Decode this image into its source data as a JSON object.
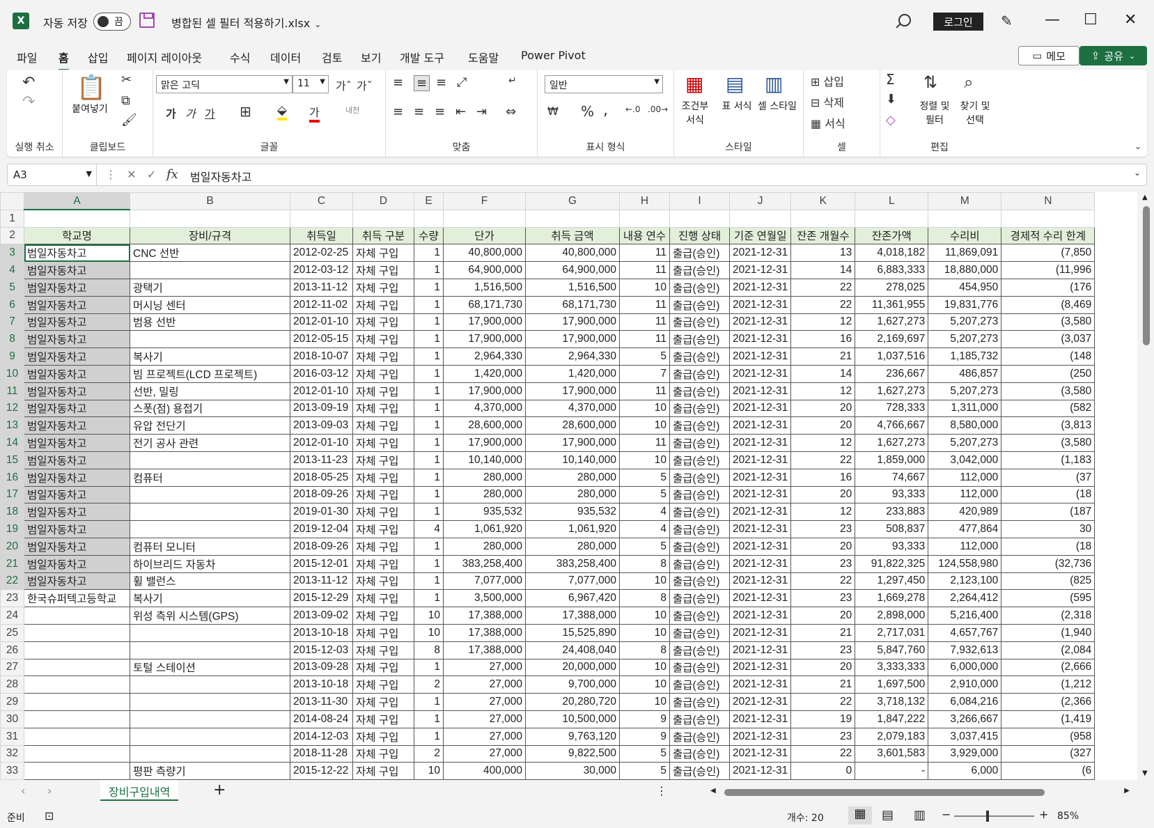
{
  "titlebar": {
    "autosave_label": "자동 저장",
    "autosave_state": "끔",
    "filename": "병합된 셀 필터 적용하기.xlsx",
    "login_label": "로그인"
  },
  "tabs": [
    "파일",
    "홈",
    "삽입",
    "페이지 레이아웃",
    "수식",
    "데이터",
    "검토",
    "보기",
    "개발 도구",
    "도움말",
    "Power Pivot"
  ],
  "active_tab": "홈",
  "memo_label": "메모",
  "share_label": "공유",
  "ribbon": {
    "undo_group": "실행 취소",
    "clipboard_group": "클립보드",
    "paste_label": "붙여넣기",
    "font_group": "글꼴",
    "font_name": "맑은 고딕",
    "font_size": "11",
    "bold": "가",
    "italic": "가",
    "underline": "가",
    "align_group": "맞춤",
    "number_group": "표시 형식",
    "number_format": "일반",
    "style_group": "스타일",
    "cond_format": "조건부 서식",
    "table_format": "표 서식",
    "cell_style": "셀 스타일",
    "cells_group": "셀",
    "insert": "삽입",
    "delete": "삭제",
    "format": "서식",
    "edit_group": "편집",
    "sort_filter": "정렬 및 필터",
    "find_select": "찾기 및 선택"
  },
  "formula_bar": {
    "name_box": "A3",
    "content": "범일자동차고"
  },
  "columns": [
    "A",
    "B",
    "C",
    "D",
    "E",
    "F",
    "G",
    "H",
    "I",
    "J",
    "K",
    "L",
    "M",
    "N"
  ],
  "header_row": [
    "학교명",
    "장비/규격",
    "취득일",
    "취득 구분",
    "수량",
    "단가",
    "취득 금액",
    "내용 연수",
    "진행 상태",
    "기준 연월일",
    "잔존 개월수",
    "잔존가액",
    "수리비",
    "경제적 수리 한계"
  ],
  "rows": [
    [
      "범일자동차고",
      "CNC 선반",
      "2012-02-25",
      "자체 구입",
      "1",
      "40,800,000",
      "40,800,000",
      "11",
      "출급(승인)",
      "2021-12-31",
      "13",
      "4,018,182",
      "11,869,091",
      "(7,850"
    ],
    [
      "범일자동차고",
      "",
      "2012-03-12",
      "자체 구입",
      "1",
      "64,900,000",
      "64,900,000",
      "11",
      "출급(승인)",
      "2021-12-31",
      "14",
      "6,883,333",
      "18,880,000",
      "(11,996"
    ],
    [
      "범일자동차고",
      "광택기",
      "2013-11-12",
      "자체 구입",
      "1",
      "1,516,500",
      "1,516,500",
      "10",
      "출급(승인)",
      "2021-12-31",
      "22",
      "278,025",
      "454,950",
      "(176"
    ],
    [
      "범일자동차고",
      "머시닝 센터",
      "2012-11-02",
      "자체 구입",
      "1",
      "68,171,730",
      "68,171,730",
      "11",
      "출급(승인)",
      "2021-12-31",
      "22",
      "11,361,955",
      "19,831,776",
      "(8,469"
    ],
    [
      "범일자동차고",
      "범용 선반",
      "2012-01-10",
      "자체 구입",
      "1",
      "17,900,000",
      "17,900,000",
      "11",
      "출급(승인)",
      "2021-12-31",
      "12",
      "1,627,273",
      "5,207,273",
      "(3,580"
    ],
    [
      "범일자동차고",
      "",
      "2012-05-15",
      "자체 구입",
      "1",
      "17,900,000",
      "17,900,000",
      "11",
      "출급(승인)",
      "2021-12-31",
      "16",
      "2,169,697",
      "5,207,273",
      "(3,037"
    ],
    [
      "범일자동차고",
      "복사기",
      "2018-10-07",
      "자체 구입",
      "1",
      "2,964,330",
      "2,964,330",
      "5",
      "출급(승인)",
      "2021-12-31",
      "21",
      "1,037,516",
      "1,185,732",
      "(148"
    ],
    [
      "범일자동차고",
      "빔 프로젝트(LCD 프로젝트)",
      "2016-03-12",
      "자체 구입",
      "1",
      "1,420,000",
      "1,420,000",
      "7",
      "출급(승인)",
      "2021-12-31",
      "14",
      "236,667",
      "486,857",
      "(250"
    ],
    [
      "범일자동차고",
      "선반, 밀링",
      "2012-01-10",
      "자체 구입",
      "1",
      "17,900,000",
      "17,900,000",
      "11",
      "출급(승인)",
      "2021-12-31",
      "12",
      "1,627,273",
      "5,207,273",
      "(3,580"
    ],
    [
      "범일자동차고",
      "스폿(점) 용접기",
      "2013-09-19",
      "자체 구입",
      "1",
      "4,370,000",
      "4,370,000",
      "10",
      "출급(승인)",
      "2021-12-31",
      "20",
      "728,333",
      "1,311,000",
      "(582"
    ],
    [
      "범일자동차고",
      "유압 전단기",
      "2013-09-03",
      "자체 구입",
      "1",
      "28,600,000",
      "28,600,000",
      "10",
      "출급(승인)",
      "2021-12-31",
      "20",
      "4,766,667",
      "8,580,000",
      "(3,813"
    ],
    [
      "범일자동차고",
      "전기 공사 관련",
      "2012-01-10",
      "자체 구입",
      "1",
      "17,900,000",
      "17,900,000",
      "11",
      "출급(승인)",
      "2021-12-31",
      "12",
      "1,627,273",
      "5,207,273",
      "(3,580"
    ],
    [
      "범일자동차고",
      "",
      "2013-11-23",
      "자체 구입",
      "1",
      "10,140,000",
      "10,140,000",
      "10",
      "출급(승인)",
      "2021-12-31",
      "22",
      "1,859,000",
      "3,042,000",
      "(1,183"
    ],
    [
      "범일자동차고",
      "컴퓨터",
      "2018-05-25",
      "자체 구입",
      "1",
      "280,000",
      "280,000",
      "5",
      "출급(승인)",
      "2021-12-31",
      "16",
      "74,667",
      "112,000",
      "(37"
    ],
    [
      "범일자동차고",
      "",
      "2018-09-26",
      "자체 구입",
      "1",
      "280,000",
      "280,000",
      "5",
      "출급(승인)",
      "2021-12-31",
      "20",
      "93,333",
      "112,000",
      "(18"
    ],
    [
      "범일자동차고",
      "",
      "2019-01-30",
      "자체 구입",
      "1",
      "935,532",
      "935,532",
      "4",
      "출급(승인)",
      "2021-12-31",
      "12",
      "233,883",
      "420,989",
      "(187"
    ],
    [
      "범일자동차고",
      "",
      "2019-12-04",
      "자체 구입",
      "4",
      "1,061,920",
      "1,061,920",
      "4",
      "출급(승인)",
      "2021-12-31",
      "23",
      "508,837",
      "477,864",
      "30"
    ],
    [
      "범일자동차고",
      "컴퓨터 모니터",
      "2018-09-26",
      "자체 구입",
      "1",
      "280,000",
      "280,000",
      "5",
      "출급(승인)",
      "2021-12-31",
      "20",
      "93,333",
      "112,000",
      "(18"
    ],
    [
      "범일자동차고",
      "하이브리드 자동차",
      "2015-12-01",
      "자체 구입",
      "1",
      "383,258,400",
      "383,258,400",
      "8",
      "출급(승인)",
      "2021-12-31",
      "23",
      "91,822,325",
      "124,558,980",
      "(32,736"
    ],
    [
      "범일자동차고",
      "휠 밸런스",
      "2013-11-12",
      "자체 구입",
      "1",
      "7,077,000",
      "7,077,000",
      "10",
      "출급(승인)",
      "2021-12-31",
      "22",
      "1,297,450",
      "2,123,100",
      "(825"
    ],
    [
      "한국슈퍼텍고등학교",
      "복사기",
      "2015-12-29",
      "자체 구입",
      "1",
      "3,500,000",
      "6,967,420",
      "8",
      "출급(승인)",
      "2021-12-31",
      "23",
      "1,669,278",
      "2,264,412",
      "(595"
    ],
    [
      "",
      "위성 측위 시스템(GPS)",
      "2013-09-02",
      "자체 구입",
      "10",
      "17,388,000",
      "17,388,000",
      "10",
      "출급(승인)",
      "2021-12-31",
      "20",
      "2,898,000",
      "5,216,400",
      "(2,318"
    ],
    [
      "",
      "",
      "2013-10-18",
      "자체 구입",
      "10",
      "17,388,000",
      "15,525,890",
      "10",
      "출급(승인)",
      "2021-12-31",
      "21",
      "2,717,031",
      "4,657,767",
      "(1,940"
    ],
    [
      "",
      "",
      "2015-12-03",
      "자체 구입",
      "8",
      "17,388,000",
      "24,408,040",
      "8",
      "출급(승인)",
      "2021-12-31",
      "23",
      "5,847,760",
      "7,932,613",
      "(2,084"
    ],
    [
      "",
      "토털 스테이션",
      "2013-09-28",
      "자체 구입",
      "1",
      "27,000",
      "20,000,000",
      "10",
      "출급(승인)",
      "2021-12-31",
      "20",
      "3,333,333",
      "6,000,000",
      "(2,666"
    ],
    [
      "",
      "",
      "2013-10-18",
      "자체 구입",
      "2",
      "27,000",
      "9,700,000",
      "10",
      "출급(승인)",
      "2021-12-31",
      "21",
      "1,697,500",
      "2,910,000",
      "(1,212"
    ],
    [
      "",
      "",
      "2013-11-30",
      "자체 구입",
      "1",
      "27,000",
      "20,280,720",
      "10",
      "출급(승인)",
      "2021-12-31",
      "22",
      "3,718,132",
      "6,084,216",
      "(2,366"
    ],
    [
      "",
      "",
      "2014-08-24",
      "자체 구입",
      "1",
      "27,000",
      "10,500,000",
      "9",
      "출급(승인)",
      "2021-12-31",
      "19",
      "1,847,222",
      "3,266,667",
      "(1,419"
    ],
    [
      "",
      "",
      "2014-12-03",
      "자체 구입",
      "1",
      "27,000",
      "9,763,120",
      "9",
      "출급(승인)",
      "2021-12-31",
      "23",
      "2,079,183",
      "3,037,415",
      "(958"
    ],
    [
      "",
      "",
      "2018-11-28",
      "자체 구입",
      "2",
      "27,000",
      "9,822,500",
      "5",
      "출급(승인)",
      "2021-12-31",
      "22",
      "3,601,583",
      "3,929,000",
      "(327"
    ],
    [
      "",
      "평판 측량기",
      "2015-12-22",
      "자체 구입",
      "10",
      "400,000",
      "30,000",
      "5",
      "출급(승인)",
      "2021-12-31",
      "0",
      "-",
      "6,000",
      "(6"
    ]
  ],
  "sheet_tab": "장비구입내역",
  "status": {
    "ready": "준비",
    "count": "개수: 20",
    "zoom": "85%"
  },
  "colors": {
    "accent": "#1d6f42",
    "header_fill": "#e2efda",
    "selection": "#d0d0d0"
  }
}
